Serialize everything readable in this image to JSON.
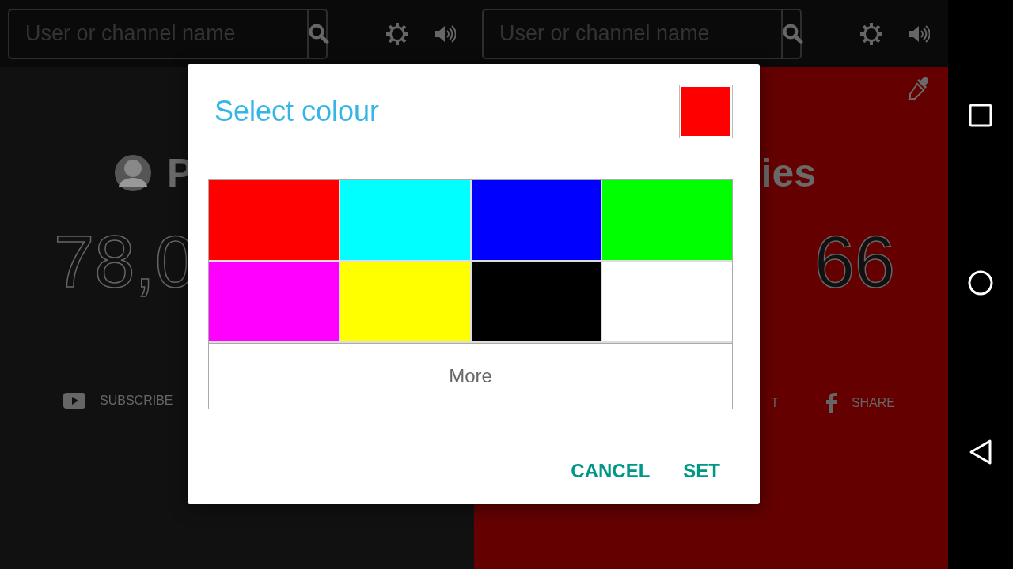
{
  "top_bars": [
    {
      "search": {
        "placeholder": "User or channel name"
      }
    },
    {
      "search": {
        "placeholder": "User or channel name"
      }
    }
  ],
  "panels": [
    {
      "color": "#111111",
      "channel_name": "P",
      "count": "78,0",
      "actions": [
        {
          "kind": "youtube",
          "label": "SUBSCRIBE"
        }
      ]
    },
    {
      "color": "#640000",
      "channel_name": "ies",
      "count": "66",
      "actions": [
        {
          "kind": "twitter",
          "label": "T"
        },
        {
          "kind": "facebook",
          "label": "SHARE"
        }
      ]
    }
  ],
  "dialog": {
    "title": "Select colour",
    "preview": {
      "color": "#ff0000"
    },
    "swatches": [
      {
        "color": "#ff0000"
      },
      {
        "color": "#00ffff"
      },
      {
        "color": "#0000ff"
      },
      {
        "color": "#00ff00"
      },
      {
        "color": "#ff00ff"
      },
      {
        "color": "#ffff00"
      },
      {
        "color": "#000000"
      },
      {
        "color": "#ffffff"
      }
    ],
    "more": "More",
    "buttons": [
      "CANCEL",
      "SET"
    ]
  }
}
